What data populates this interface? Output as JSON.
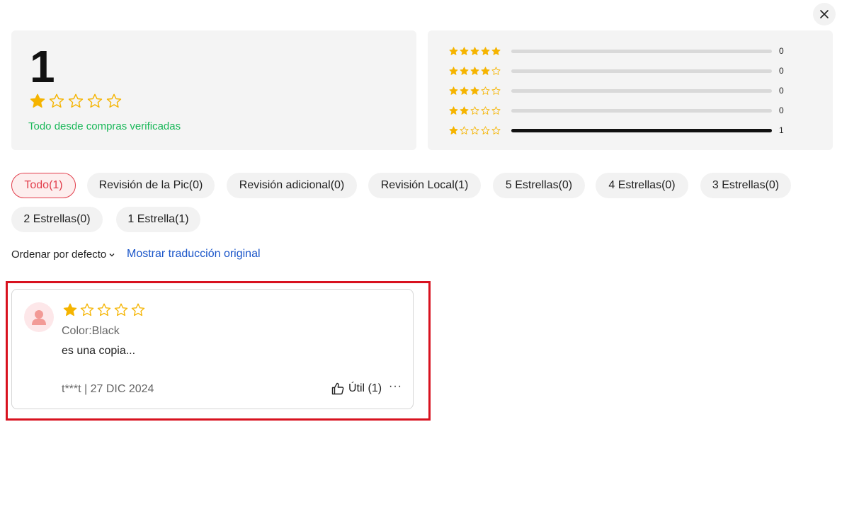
{
  "close": {
    "icon": "close-icon"
  },
  "summary": {
    "score": "1",
    "rating": 1,
    "max_rating": 5,
    "verified_text": "Todo desde compras verificadas"
  },
  "distribution": [
    {
      "stars": 5,
      "count": "0",
      "fraction": 0
    },
    {
      "stars": 4,
      "count": "0",
      "fraction": 0
    },
    {
      "stars": 3,
      "count": "0",
      "fraction": 0
    },
    {
      "stars": 2,
      "count": "0",
      "fraction": 0
    },
    {
      "stars": 1,
      "count": "1",
      "fraction": 1
    }
  ],
  "filters": [
    {
      "label": "Todo(1)",
      "active": true
    },
    {
      "label": "Revisión de la Pic(0)",
      "active": false
    },
    {
      "label": "Revisión adicional(0)",
      "active": false
    },
    {
      "label": "Revisión Local(1)",
      "active": false
    },
    {
      "label": "5 Estrellas(0)",
      "active": false
    },
    {
      "label": "4 Estrellas(0)",
      "active": false
    },
    {
      "label": "3 Estrellas(0)",
      "active": false
    },
    {
      "label": "2 Estrellas(0)",
      "active": false
    },
    {
      "label": "1 Estrella(1)",
      "active": false
    }
  ],
  "sort": {
    "label": "Ordenar por defecto",
    "icon": "chevron-down-icon"
  },
  "translate_link": "Mostrar traducción original",
  "review": {
    "rating": 1,
    "color": "Color:Black",
    "text": "es una copia...",
    "meta": "t***t | 27 DIC 2024",
    "helpful": "Útil (1)",
    "more": "···",
    "avatar_icon": "user-avatar-icon",
    "helpful_icon": "thumbs-up-icon"
  },
  "colors": {
    "star": "#f5b400",
    "verified": "#1bb85a",
    "accent": "#e23d4b",
    "link": "#1a55c9",
    "highlight": "#d8121f"
  }
}
